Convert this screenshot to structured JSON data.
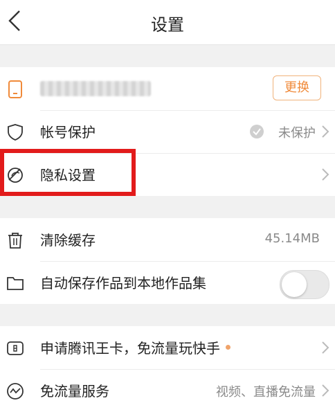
{
  "nav": {
    "title": "设置"
  },
  "account": {
    "swap_label": "更换",
    "protect_label": "帐号保护",
    "protect_status": "未保护",
    "privacy_label": "隐私设置"
  },
  "storage": {
    "clear_label": "清除缓存",
    "cache_size": "45.14MB",
    "autosave_label": "自动保存作品到本地作品集",
    "autosave_on": false
  },
  "extras": {
    "card_label": "申请腾讯王卡，免流量玩快手",
    "free_label": "免流量服务",
    "free_value": "视频、直播免流量"
  },
  "colors": {
    "accent": "#f08a3a",
    "highlight": "#e21b1b"
  }
}
